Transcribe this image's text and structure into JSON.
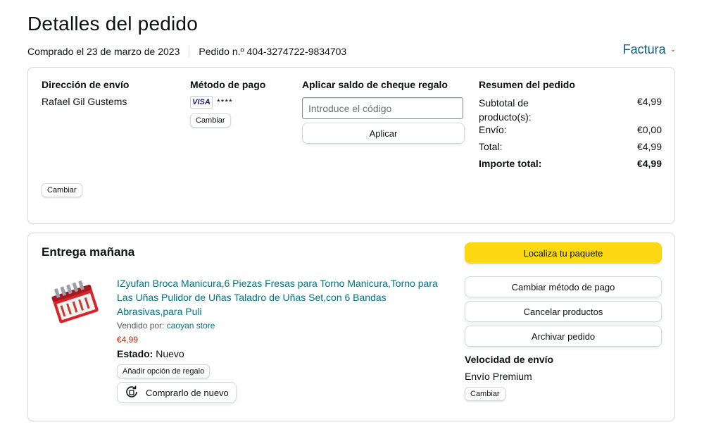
{
  "header": {
    "title": "Detalles del pedido",
    "purchased": "Comprado el 23 de marzo de 2023",
    "order_number": "Pedido n.º 404-3274722-9834703",
    "invoice_label": "Factura"
  },
  "summary_box": {
    "shipping_address": {
      "title": "Dirección de envío",
      "name": "Rafael Gil Gustems",
      "change_label": "Cambiar"
    },
    "payment_method": {
      "title": "Método de pago",
      "card_brand": "VISA",
      "card_mask": "****",
      "change_label": "Cambiar"
    },
    "gift_card": {
      "title": "Aplicar saldo de cheque regalo",
      "placeholder": "Introduce el código",
      "apply_label": "Aplicar"
    },
    "order_summary": {
      "title": "Resumen del pedido",
      "rows": [
        {
          "label": "Subtotal de producto(s):",
          "value": "€4,99"
        },
        {
          "label": "Envío:",
          "value": "€0,00"
        },
        {
          "label": "Total:",
          "value": "€4,99"
        },
        {
          "label": "Importe total:",
          "value": "€4,99"
        }
      ]
    }
  },
  "delivery": {
    "title": "Entrega mañana",
    "product": {
      "title": "IZyufan Broca Manicura,6 Piezas Fresas para Torno Manicura,Torno para Las Uñas Pulidor de Uñas Taladro de Uñas Set,con 6 Bandas Abrasivas,para Puli",
      "sold_by_label": "Vendido por:",
      "seller": "caoyan store",
      "price": "€4,99",
      "state_label": "Estado:",
      "state_value": "Nuevo",
      "gift_option_label": "Añadir opción de regalo",
      "buy_again_label": "Comprarlo de nuevo"
    },
    "actions": {
      "track": "Localiza tu paquete",
      "change_payment": "Cambiar método de pago",
      "cancel": "Cancelar productos",
      "archive": "Archivar pedido"
    },
    "shipping_speed": {
      "title": "Velocidad de envío",
      "value": "Envío Premium",
      "change_label": "Cambiar"
    }
  },
  "colors": {
    "link": "#007185",
    "invoice_link": "#0f5b7a",
    "price": "#b12704",
    "primary_button": "#ffd814",
    "border": "#d5d9d9"
  }
}
